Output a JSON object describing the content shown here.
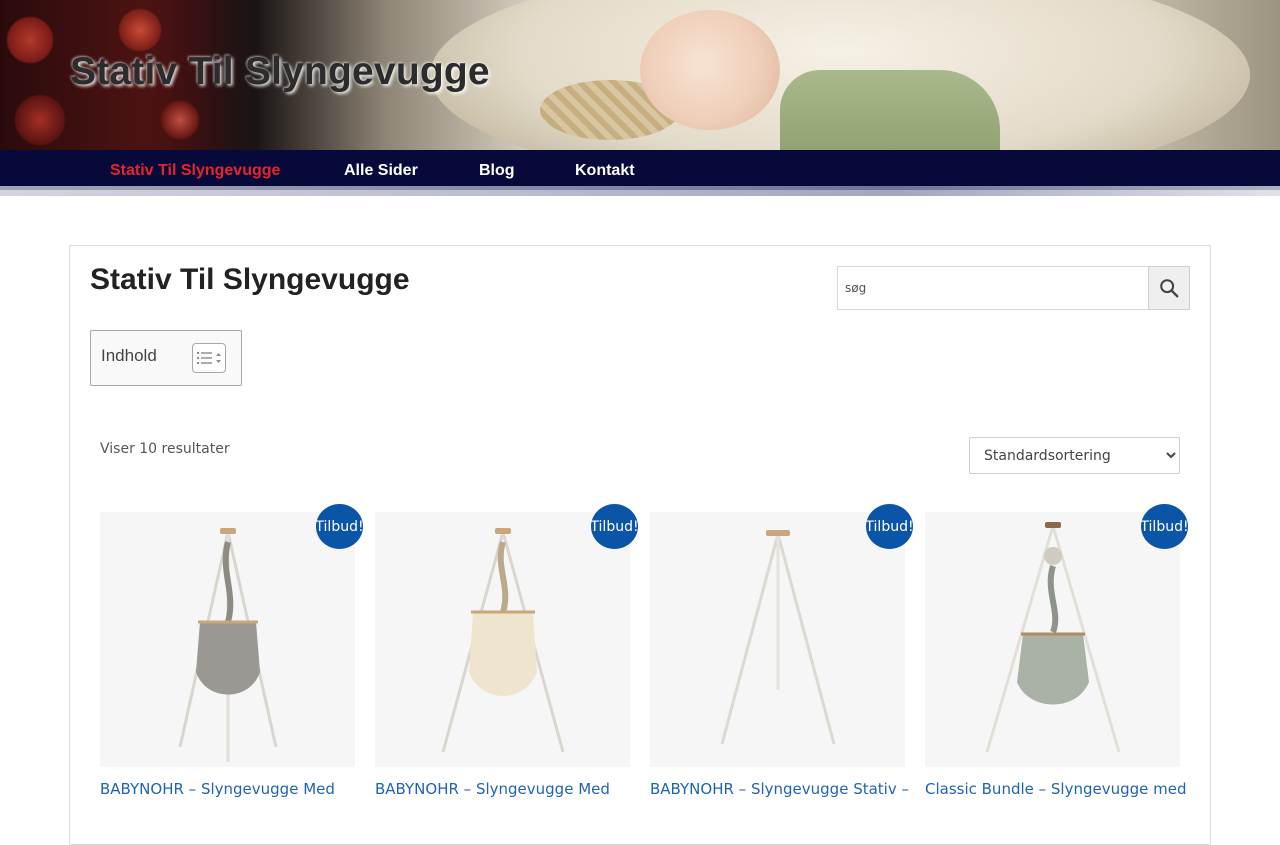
{
  "site": {
    "title": "Stativ Til Slyngevugge"
  },
  "nav": {
    "items": [
      {
        "label": "Stativ Til Slyngevugge",
        "active": true
      },
      {
        "label": "Alle Sider"
      },
      {
        "label": "Blog"
      },
      {
        "label": "Kontakt"
      }
    ]
  },
  "page": {
    "title": "Stativ Til Slyngevugge"
  },
  "search": {
    "placeholder": "søg",
    "icon": "search-icon"
  },
  "toc": {
    "label": "Indhold",
    "icon": "list-toggle-icon"
  },
  "shop": {
    "result_count": "Viser 10 resultater",
    "sort_options": [
      "Standardsortering"
    ],
    "sort_selected": "Standardsortering"
  },
  "colors": {
    "nav_bg": "#06093a",
    "nav_active": "#e8242b",
    "badge": "#0a55a8",
    "link": "#1f63b5"
  },
  "products": [
    {
      "badge": "Tilbud!",
      "title": "BABYNOHR – Slyngevugge Med"
    },
    {
      "badge": "Tilbud!",
      "title": "BABYNOHR – Slyngevugge Med"
    },
    {
      "badge": "Tilbud!",
      "title": "BABYNOHR – Slyngevugge Stativ –"
    },
    {
      "badge": "Tilbud!",
      "title": "Classic Bundle – Slyngevugge med"
    }
  ]
}
